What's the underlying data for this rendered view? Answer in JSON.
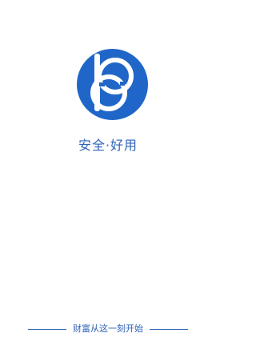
{
  "splash": {
    "slogan": "安全·好用",
    "tagline": "财富从这一刻开始",
    "logo_icon": "bs-monogram-logo",
    "brand_color": "#1f66c8"
  }
}
